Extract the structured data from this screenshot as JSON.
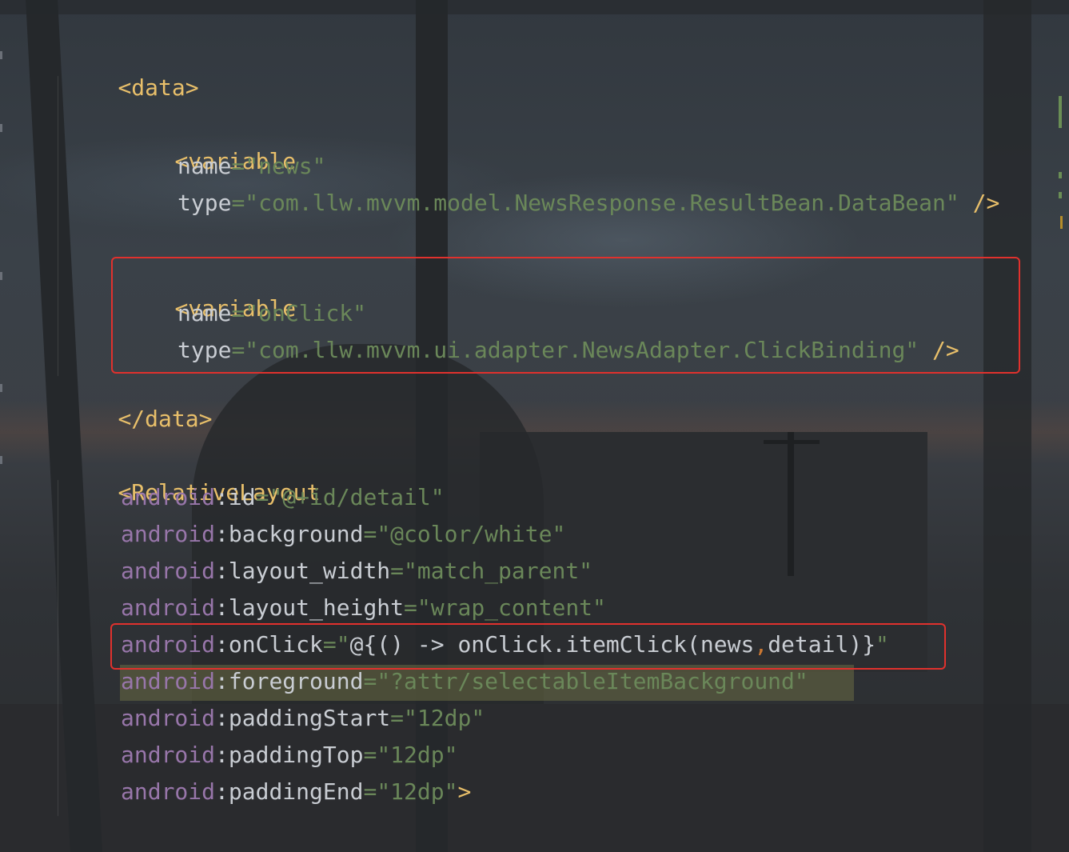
{
  "editor": {
    "lines": [
      {
        "id": "data-open",
        "tag": "<data>"
      },
      {
        "id": "var1-open",
        "tag": "<variable"
      },
      {
        "id": "var1-name",
        "attr": "name",
        "eq": "=",
        "value": "\"news\""
      },
      {
        "id": "var1-type",
        "attr": "type",
        "eq": "=",
        "value": "\"com.llw.mvvm.model.NewsResponse.ResultBean.DataBean\"",
        "close": " />"
      },
      {
        "id": "var2-open",
        "tag": "<variable"
      },
      {
        "id": "var2-name",
        "attr": "name",
        "eq": "=",
        "value": "\"onClick\""
      },
      {
        "id": "var2-type",
        "attr": "type",
        "eq": "=",
        "value": "\"com.llw.mvvm.ui.adapter.NewsAdapter.ClickBinding\"",
        "close": " />"
      },
      {
        "id": "data-close",
        "tag": "</data>"
      },
      {
        "id": "rl-open",
        "tag": "<RelativeLayout"
      },
      {
        "id": "rl-id",
        "ns": "android",
        "attr": ":id",
        "eq": "=",
        "value": "\"@+id/detail\""
      },
      {
        "id": "rl-bg",
        "ns": "android",
        "attr": ":background",
        "eq": "=",
        "value": "\"@color/white\""
      },
      {
        "id": "rl-lw",
        "ns": "android",
        "attr": ":layout_width",
        "eq": "=",
        "value": "\"match_parent\""
      },
      {
        "id": "rl-lh",
        "ns": "android",
        "attr": ":layout_height",
        "eq": "=",
        "value": "\"wrap_content\""
      },
      {
        "id": "rl-onclick",
        "ns": "android",
        "attr": ":onClick",
        "eq": "=",
        "q1": "\"",
        "expr_a": "@{() -> onClick.itemClick(news",
        "comma": ",",
        "expr_b": "detail)}",
        "q2": "\""
      },
      {
        "id": "rl-fg",
        "ns": "android",
        "attr": ":foreground",
        "eq": "=",
        "value": "\"?attr/selectableItemBackground\""
      },
      {
        "id": "rl-ps",
        "ns": "android",
        "attr": ":paddingStart",
        "eq": "=",
        "value": "\"12dp\""
      },
      {
        "id": "rl-pt",
        "ns": "android",
        "attr": ":paddingTop",
        "eq": "=",
        "value": "\"12dp\""
      },
      {
        "id": "rl-pe",
        "ns": "android",
        "attr": ":paddingEnd",
        "eq": "=",
        "value": "\"12dp\"",
        "close": ">"
      }
    ]
  },
  "colors": {
    "tag": "#e8bf6a",
    "namespace": "#9876aa",
    "string": "#6a8759",
    "highlight_box": "#e0312d",
    "match_highlight": "#787846"
  }
}
